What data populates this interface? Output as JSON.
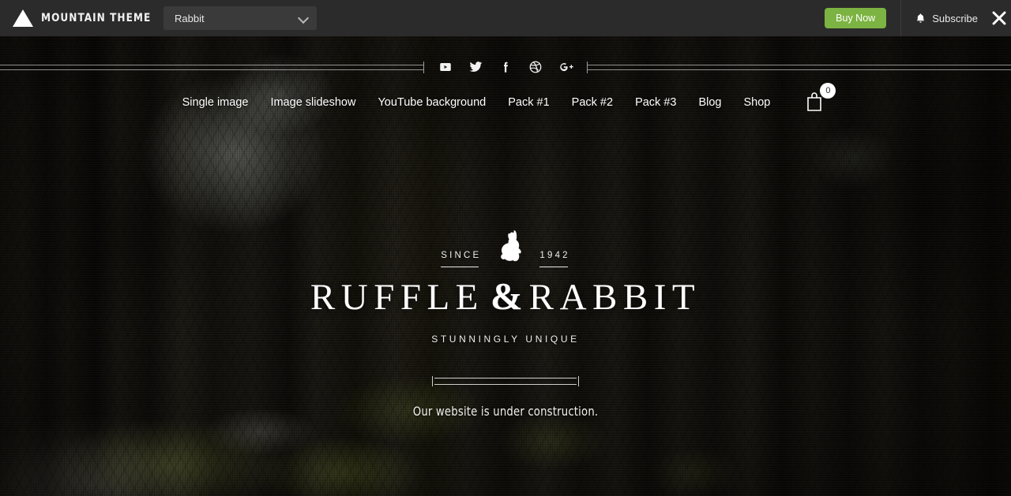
{
  "topbar": {
    "brand_name": "MOUNTAIN THEME",
    "brand_icon": "mountain-triangle-icon",
    "theme_select": {
      "value": "Rabbit",
      "chevron_icon": "chevron-down-icon"
    },
    "buy_now_label": "Buy Now",
    "subscribe_label": "Subscribe",
    "subscribe_icon": "bell-icon",
    "close_icon": "close-icon",
    "accent_color": "#7cb342",
    "bar_color": "#2b2b2b"
  },
  "social": [
    {
      "name": "youtube-icon",
      "label": "YouTube"
    },
    {
      "name": "twitter-icon",
      "label": "Twitter"
    },
    {
      "name": "facebook-icon",
      "label": "Facebook"
    },
    {
      "name": "dribbble-icon",
      "label": "Dribbble"
    },
    {
      "name": "googleplus-icon",
      "label": "Google Plus"
    }
  ],
  "nav": {
    "items": [
      {
        "label": "Single image"
      },
      {
        "label": "Image slideshow"
      },
      {
        "label": "YouTube background"
      },
      {
        "label": "Pack #1"
      },
      {
        "label": "Pack #2"
      },
      {
        "label": "Pack #3"
      },
      {
        "label": "Blog"
      },
      {
        "label": "Shop"
      }
    ],
    "cart": {
      "icon": "shopping-bag-icon",
      "count": "0"
    }
  },
  "hero": {
    "logo": {
      "since_word": "SINCE",
      "since_year": "1942",
      "animal_icon": "rabbit-icon",
      "wordmark_first": "RUFFLE",
      "wordmark_amp": "&",
      "wordmark_second": "RABBIT",
      "tagline": "STUNNINGLY UNIQUE"
    },
    "construction_text": "Our website is under construction.",
    "background_image": "dark-forest-path-photo"
  }
}
